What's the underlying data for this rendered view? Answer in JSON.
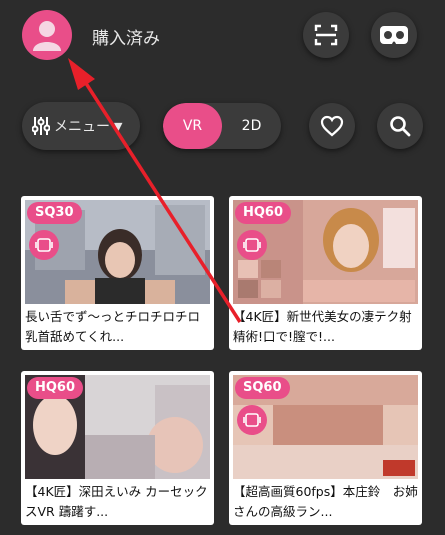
{
  "header": {
    "title": "購入済み"
  },
  "toolbar": {
    "menu_label": "メニュー",
    "segment": [
      {
        "label": "VR",
        "active": true
      },
      {
        "label": "2D",
        "active": false
      }
    ]
  },
  "colors": {
    "accent": "#e94e89",
    "background": "#2c2c2c",
    "button": "#3b3b3b",
    "arrow": "#e8202a"
  },
  "videos": [
    {
      "badge": "SQ30",
      "caption": "長い舌でず～っとチロチロチロ乳首舐めてくれ..."
    },
    {
      "badge": "HQ60",
      "caption": "【4K匠】新世代美女の凄テク射精術!口で!膣で!..."
    },
    {
      "badge": "HQ60",
      "caption": "【4K匠】深田えいみ カーセックスVR 躊躇す..."
    },
    {
      "badge": "SQ60",
      "caption": "【超高画質60fps】本庄鈴　お姉さんの高級ラン..."
    }
  ]
}
